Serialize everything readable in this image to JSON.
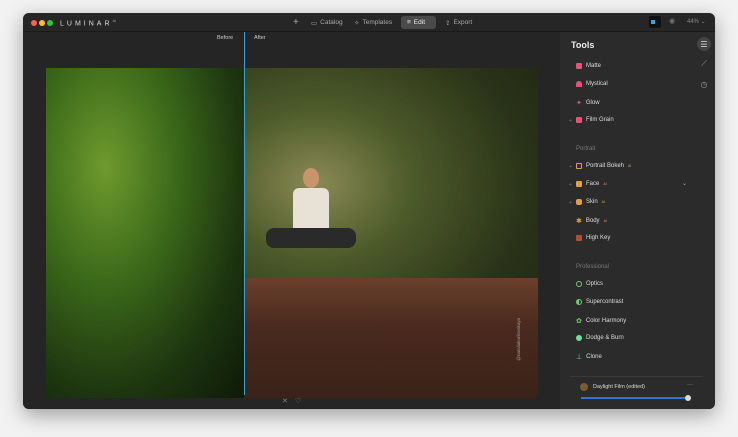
{
  "app": {
    "name": "LUMINAR",
    "version": "AI"
  },
  "nav": {
    "add": "+",
    "catalog": "Catalog",
    "templates": "Templates",
    "edit": "Edit",
    "export": "Export"
  },
  "view": {
    "zoom": "44%"
  },
  "compare": {
    "before": "Before",
    "after": "After"
  },
  "photo": {
    "watermark": "@nataliakurilovskaya"
  },
  "tools": {
    "title": "Tools",
    "creative": [
      {
        "label": "Matte",
        "color": "#e8507a"
      },
      {
        "label": "Mystical",
        "color": "#e8507a"
      },
      {
        "label": "Glow",
        "color": "#e8507a"
      },
      {
        "label": "Film Grain",
        "color": "#e8507a"
      }
    ],
    "portrait_title": "Portrait",
    "portrait": [
      {
        "label": "Portrait Bokeh",
        "badge": "AI",
        "color": "#e0a040"
      },
      {
        "label": "Face",
        "badge": "AI",
        "color": "#e0a040"
      },
      {
        "label": "Skin",
        "badge": "AI",
        "color": "#e0a040"
      },
      {
        "label": "Body",
        "badge": "AI",
        "color": "#e0a040"
      },
      {
        "label": "High Key",
        "badge": "",
        "color": "#e0a040"
      }
    ],
    "professional_title": "Professional",
    "professional": [
      {
        "label": "Optics",
        "color": "#6fd06a"
      },
      {
        "label": "Supercontrast",
        "color": "#6fd06a"
      },
      {
        "label": "Color Harmony",
        "color": "#6fd06a"
      },
      {
        "label": "Dodge & Burn",
        "color": "#6fe0a0"
      },
      {
        "label": "Clone",
        "color": "#6fe0c0"
      }
    ]
  },
  "preset": {
    "name": "Daylight Film (edited)",
    "more": "···",
    "amount": 0.97,
    "accent": "#3a6fd8"
  }
}
